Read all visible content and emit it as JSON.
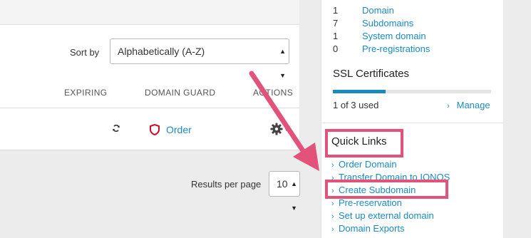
{
  "sort": {
    "label": "Sort by",
    "value": "Alphabetically (A-Z)"
  },
  "table": {
    "headers": {
      "expiring": "EXPIRING",
      "domain_guard": "DOMAIN GUARD",
      "actions": "ACTIONS"
    },
    "row": {
      "order_label": "Order"
    }
  },
  "pagination": {
    "label": "Results per page",
    "value": "10"
  },
  "sidebar": {
    "stats": [
      {
        "count": "1",
        "label": "Domain"
      },
      {
        "count": "7",
        "label": "Subdomains"
      },
      {
        "count": "1",
        "label": "System domain"
      },
      {
        "count": "0",
        "label": "Pre-registrations"
      }
    ],
    "ssl": {
      "title": "SSL Certificates",
      "used_text": "1 of 3 used",
      "manage_label": "Manage",
      "used_fraction": 0.333
    },
    "quick_links": {
      "title": "Quick Links",
      "items": [
        {
          "label": "Order Domain"
        },
        {
          "label": "Transfer Domain to IONOS"
        },
        {
          "label": "Create Subdomain"
        },
        {
          "label": "Pre-reservation"
        },
        {
          "label": "Set up external domain"
        },
        {
          "label": "Domain Exports"
        }
      ]
    }
  },
  "colors": {
    "link": "#1a8bbf",
    "annotation": "#e2527a",
    "guard_icon": "#c8102e"
  }
}
